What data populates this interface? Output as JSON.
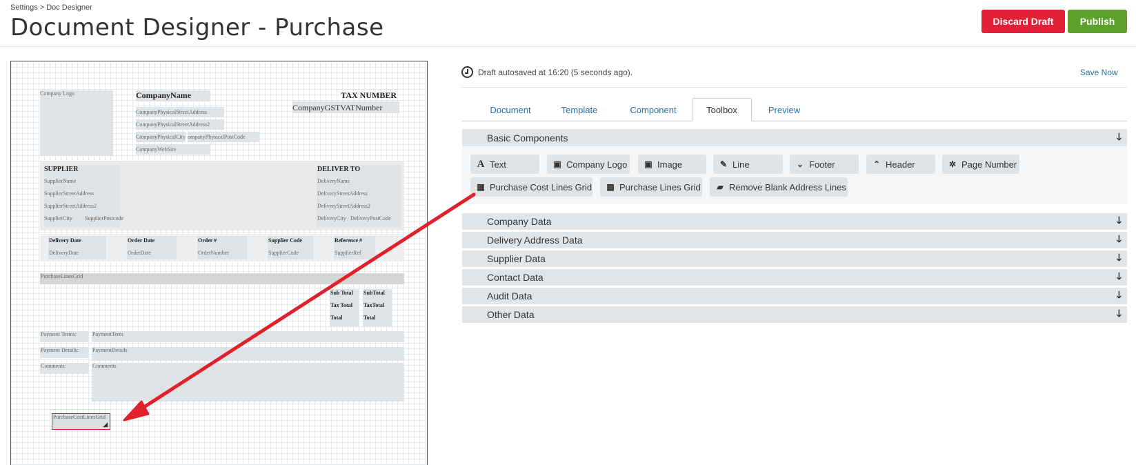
{
  "breadcrumb": {
    "settings": "Settings",
    "sep": ">",
    "current": "Doc Designer"
  },
  "page_title": "Document Designer - Purchase",
  "header": {
    "discard_label": "Discard Draft",
    "publish_label": "Publish"
  },
  "autosave": {
    "text": "Draft autosaved at 16:20 (5 seconds ago).",
    "save_now": "Save Now"
  },
  "tabs": [
    "Document",
    "Template",
    "Component",
    "Toolbox",
    "Preview"
  ],
  "active_tab": "Toolbox",
  "basic": {
    "title": "Basic Components",
    "tools": [
      {
        "label": "Text",
        "icon": "text-icon"
      },
      {
        "label": "Company Logo",
        "icon": "image-icon"
      },
      {
        "label": "Image",
        "icon": "image-icon"
      },
      {
        "label": "Line",
        "icon": "pencil-icon"
      },
      {
        "label": "Footer",
        "icon": "chevron-down-icon"
      },
      {
        "label": "Header",
        "icon": "chevron-up-icon"
      },
      {
        "label": "Page Number",
        "icon": "gear-icon"
      },
      {
        "label": "Purchase Cost Lines Grid",
        "icon": "grid-icon"
      },
      {
        "label": "Purchase Lines Grid",
        "icon": "grid-icon"
      },
      {
        "label": "Remove Blank Address Lines",
        "icon": "book-icon"
      }
    ]
  },
  "sections": [
    "Company Data",
    "Delivery Address Data",
    "Supplier Data",
    "Contact Data",
    "Audit Data",
    "Other Data"
  ],
  "canvas": {
    "company_logo": "Company Logo",
    "company_name": "CompanyName",
    "addr1": "CompanyPhysicalStreetAddress",
    "addr2": "CompanyPhysicalStreetAddress2",
    "city": "CompanyPhysicalCity",
    "postcode": "ompanyPhysicalPostCode",
    "website": "CompanyWebSite",
    "tax_number": "TAX NUMBER",
    "gst": "CompanyGSTVATNumber",
    "supplier": "SUPPLIER",
    "supplier_name": "SupplierName",
    "supplier_addr": "SupplierStreetAddress",
    "supplier_addr2": "SupplierStreetAddress2",
    "supplier_city": "SupplierCity",
    "supplier_postcode": "SupplierPostcode",
    "deliver_to": "DELIVER TO",
    "delivery_name": "DeliveryName",
    "delivery_addr": "DeliveryStreetAddress",
    "delivery_addr2": "DeliveryStreetAddress2",
    "delivery_city": "DeliveryCity",
    "delivery_postcode": "DeliveryPostCode",
    "delivery_date_label": "Delivery Date",
    "delivery_date": "DeliveryDate",
    "order_date_label": "Order Date",
    "order_date": "OrderDate",
    "order_num_label": "Order #",
    "order_number": "OrderNumber",
    "supplier_code_label": "Supplier Code",
    "supplier_code": "SupplierCode",
    "reference_label": "Reference #",
    "supplier_ref": "SupplierRef",
    "purchase_lines_grid": "PurchaseLinesGrid",
    "sub_total_label": "Sub Total",
    "tax_total_label": "Tax Total",
    "total_label": "Total",
    "sub_total": "SubTotal",
    "tax_total": "TaxTotal",
    "total": "Total",
    "payment_terms_label": "Payment Terms:",
    "payment_term": "PaymentTerm",
    "payment_details_label": "Payment Details:",
    "payment_details": "PaymentDetails",
    "comments_label": "Comments:",
    "comments": "Comments",
    "purchase_cost_lines_grid": "PurchaseCostLinesGrid"
  },
  "colors": {
    "discard": "#e02138",
    "publish": "#5ea22c",
    "link": "#2a6fa8",
    "arrow": "#e0202a"
  }
}
